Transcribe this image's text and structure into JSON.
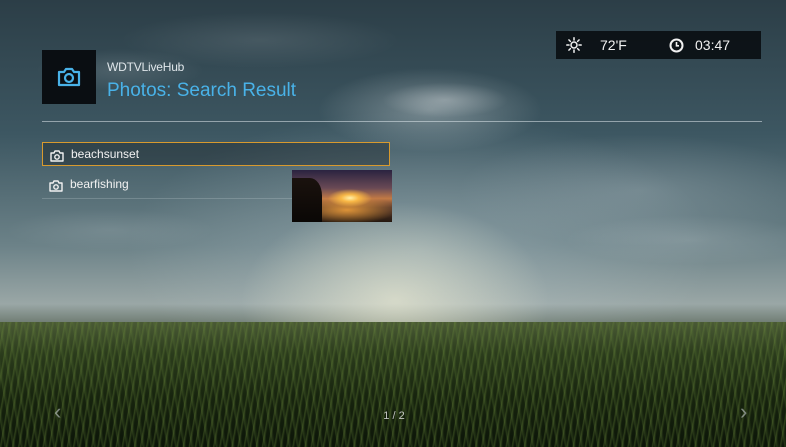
{
  "header": {
    "app_name": "WDTVLiveHub",
    "title": "Photos: Search Result",
    "app_icon": "camera-icon"
  },
  "status": {
    "weather_icon": "sun-icon",
    "temperature": "72'F",
    "clock_icon": "clock-icon",
    "time": "03:47"
  },
  "results": [
    {
      "label": "beachsunset",
      "icon": "camera-icon",
      "selected": true
    },
    {
      "label": "bearfishing",
      "icon": "camera-icon",
      "selected": false
    }
  ],
  "preview": {
    "icon": "photo-thumbnail"
  },
  "footer": {
    "prev": "‹",
    "page": "1 / 2",
    "next": "›"
  },
  "colors": {
    "accent_title": "#49b2e8",
    "selection_border": "#d89a2e",
    "panel_bg": "#0a0e12"
  }
}
